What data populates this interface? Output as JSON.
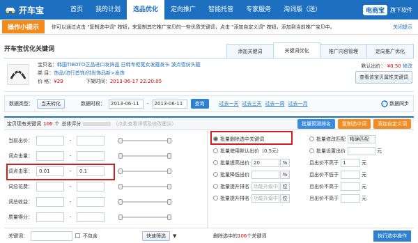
{
  "nav": {
    "logo": "开车宝",
    "items": [
      "首页",
      "我的计划",
      "选品优化",
      "定向推广",
      "智能托管",
      "专家服务",
      "淘词版（送）"
    ],
    "active": 2,
    "brand_badge": "电商宝",
    "brand_text": "旗下软件"
  },
  "tip": {
    "label": "操作小提示",
    "text": "你可以通过点击 \"复制选中词\" 按钮，来复制其它推广宝贝的一些优质关键词，点击 \"添加自定义词\" 按钮，添加到当前推广宝贝中。",
    "close": "关闭提示"
  },
  "page": {
    "title": "开车宝优化关键词",
    "tabs": [
      "添加关键词",
      "关键词优化",
      "推广内容管理",
      "定向推广优化"
    ],
    "active_tab": 1
  },
  "product": {
    "name_label": "宝贝名：",
    "name": "韩国TIBOTO正品进口发饰品 日韩专柜宽女发箍发卡 波点雪纺头箍",
    "category_label": "类 目：",
    "category": "饰品/流行首饰/时尚饰品新>发饰",
    "price_label": "价 格：",
    "price": "¥29",
    "ship_label": "下架时间：",
    "ship_time": "2013-06-17 22:20:05",
    "default_bid_label": "默认出价：",
    "default_bid": "¥0.50",
    "edit": "修改",
    "view_btn": "查看该宝贝属性关键词"
  },
  "filter": {
    "type_label": "数据类型：",
    "type_value": "当天转化",
    "period_label": "数据时段：",
    "date_from": "2013-06-11",
    "date_to": "2013-06-11",
    "query_btn": "查询",
    "quick": [
      "过去一天",
      "过去三天",
      "过去一周",
      "过去一月"
    ],
    "sync": "数据同步"
  },
  "kwbar": {
    "text": "宝贝现有关键词",
    "count": "106",
    "unit": "个",
    "score_label": "总体评分",
    "hint": "（点此查看详情及修改建议）",
    "buttons": [
      "批量预测排名",
      "复制选中词",
      "添加自定义词"
    ]
  },
  "filters_left": [
    {
      "label": "当前出价：",
      "min": "",
      "max": ""
    },
    {
      "label": "词点击量：",
      "min": "",
      "max": ""
    },
    {
      "label": "词点击率：",
      "min": "0.01",
      "max": "0.1"
    },
    {
      "label": "词总花费：",
      "min": "",
      "max": ""
    },
    {
      "label": "词总收益：",
      "min": "",
      "max": ""
    },
    {
      "label": "质量得分：",
      "min": "",
      "max": ""
    }
  ],
  "ops": {
    "rows": [
      {
        "left": "批量删除选中关键词",
        "right": "批量修改匹配",
        "rvalue": "精确匹配"
      },
      {
        "left": "批量使用默认出价（0.5元）",
        "right": "批量设置出价",
        "rvalue": ""
      },
      {
        "left": "批量提高出价",
        "lvalue": "20",
        "lunit": "%",
        "right": "且出价不高于",
        "rvalue": "1",
        "runit": "元"
      },
      {
        "left": "批量降低出价",
        "lvalue": "",
        "lunit": "%",
        "right": "且出价不低于",
        "rvalue": "",
        "runit": "元"
      },
      {
        "left": "批量提升排名",
        "lvalue": "功能升级中",
        "lunit": "位",
        "right": "且出价不高于",
        "rvalue": "",
        "runit": "元"
      },
      {
        "left": "批量提升排名",
        "lvalue": "功能升级中",
        "lunit": "位",
        "right": "且出价不高于",
        "rvalue": "",
        "runit": "元"
      }
    ]
  },
  "footer": {
    "kw_label": "关键词：",
    "exclude": "不包含",
    "quick_filter": "快速筛选",
    "selected_prefix": "删除选中的",
    "selected_count": "106",
    "selected_suffix": "个关键词",
    "run_btn": "执行选中操作"
  },
  "colors": {
    "primary": "#1d6fc0",
    "accent": "#f48a1a",
    "highlight": "#d21d1d"
  }
}
